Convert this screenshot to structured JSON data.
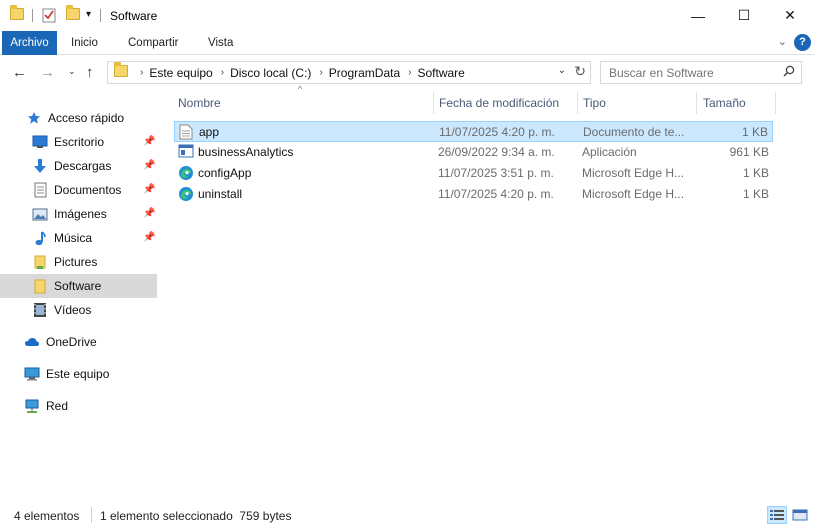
{
  "window": {
    "title": "Software",
    "minimize_glyph": "—",
    "maximize_glyph": "☐",
    "close_glyph": "✕"
  },
  "ribbon": {
    "tabs": [
      {
        "label": "Archivo"
      },
      {
        "label": "Inicio"
      },
      {
        "label": "Compartir"
      },
      {
        "label": "Vista"
      }
    ],
    "help_glyph": "?"
  },
  "address": {
    "crumbs": [
      "Este equipo",
      "Disco local (C:)",
      "ProgramData",
      "Software"
    ],
    "search_placeholder": "Buscar en Software"
  },
  "nav": {
    "quick_access": {
      "label": "Acceso rápido",
      "icon": "star-icon"
    },
    "items": [
      {
        "label": "Escritorio",
        "icon": "desktop-icon",
        "pinned": true
      },
      {
        "label": "Descargas",
        "icon": "download-icon",
        "pinned": true
      },
      {
        "label": "Documentos",
        "icon": "document-icon",
        "pinned": true
      },
      {
        "label": "Imágenes",
        "icon": "pictures-icon",
        "pinned": true
      },
      {
        "label": "Música",
        "icon": "music-icon",
        "pinned": true
      },
      {
        "label": "Pictures",
        "icon": "folder-icon",
        "pinned": false
      },
      {
        "label": "Software",
        "icon": "folder-icon",
        "pinned": false,
        "selected": true
      },
      {
        "label": "Vídeos",
        "icon": "video-icon",
        "pinned": false
      }
    ],
    "onedrive": {
      "label": "OneDrive",
      "icon": "cloud-icon"
    },
    "this_pc": {
      "label": "Este equipo",
      "icon": "computer-icon"
    },
    "network": {
      "label": "Red",
      "icon": "network-icon"
    }
  },
  "files": {
    "columns": [
      "Nombre",
      "Fecha de modificación",
      "Tipo",
      "Tamaño"
    ],
    "rows": [
      {
        "name": "app",
        "date": "11/07/2025 4:20 p. m.",
        "type": "Documento de te...",
        "size": "1 KB",
        "icon": "text-file-icon",
        "selected": true
      },
      {
        "name": "businessAnalytics",
        "date": "26/09/2022 9:34 a. m.",
        "type": "Aplicación",
        "size": "961 KB",
        "icon": "application-icon",
        "selected": false
      },
      {
        "name": "configApp",
        "date": "11/07/2025 3:51 p. m.",
        "type": "Microsoft Edge H...",
        "size": "1 KB",
        "icon": "edge-icon",
        "selected": false
      },
      {
        "name": "uninstall",
        "date": "11/07/2025 4:20 p. m.",
        "type": "Microsoft Edge H...",
        "size": "1 KB",
        "icon": "edge-icon",
        "selected": false
      }
    ]
  },
  "status": {
    "count": "4 elementos",
    "selection": "1 elemento seleccionado  759 bytes"
  },
  "colors": {
    "accent": "#1a66b7",
    "selection_bg": "#cce8ff",
    "selection_border": "#99d1ff",
    "nav_selected": "#d9d9d9"
  }
}
